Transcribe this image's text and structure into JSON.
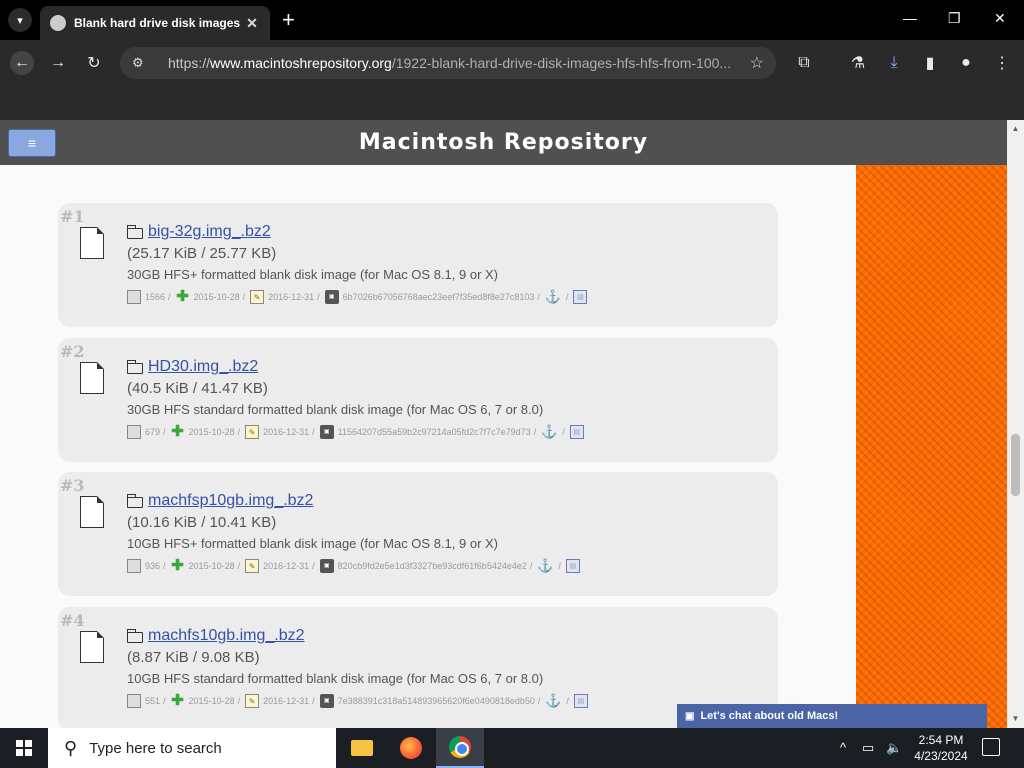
{
  "browser": {
    "tab_title": "Blank hard drive disk images H",
    "tab_close": "✕",
    "new_tab": "+",
    "url_prefix": "https://",
    "url_host": "www.macintoshrepository.org",
    "url_path": "/1922-blank-hard-drive-disk-images-hfs-hfs-from-100...",
    "window_controls": {
      "minimize": "—",
      "restore": "❐",
      "close": "✕"
    }
  },
  "site": {
    "menu_glyph": "≡",
    "title": "Macintosh Repository"
  },
  "items": [
    {
      "num": "#1",
      "name": "big-32g.img_.bz2",
      "size": "(25.17 KiB / 25.77 KB)",
      "desc": "30GB HFS+ formatted blank disk image (for Mac OS 8.1, 9 or X)",
      "downloads": "1566",
      "added": "2015-10-28",
      "edited": "2016-12-31",
      "sha": "6b7026b67056768aec23eef7f35ed8f8e27c8103"
    },
    {
      "num": "#2",
      "name": "HD30.img_.bz2",
      "size": "(40.5 KiB / 41.47 KB)",
      "desc": "30GB HFS standard formatted blank disk image (for Mac OS 6, 7 or 8.0)",
      "downloads": "679",
      "added": "2015-10-28",
      "edited": "2016-12-31",
      "sha": "11564207d55a59b2c97214a05fd2c7f7c7e79d73"
    },
    {
      "num": "#3",
      "name": "machfsp10gb.img_.bz2",
      "size": "(10.16 KiB / 10.41 KB)",
      "desc": "10GB HFS+ formatted blank disk image (for Mac OS 8.1, 9 or X)",
      "downloads": "936",
      "added": "2015-10-28",
      "edited": "2016-12-31",
      "sha": "820cb9fd2e5e1d3f3327be93cdf61f6b5424e4e2"
    },
    {
      "num": "#4",
      "name": "machfs10gb.img_.bz2",
      "size": "(8.87 KiB / 9.08 KB)",
      "desc": "10GB HFS standard formatted blank disk image (for Mac OS 6, 7 or 8.0)",
      "downloads": "551",
      "added": "2015-10-28",
      "edited": "2016-12-31",
      "sha": "7e388391c318a514893965620f6e0490818edb50"
    }
  ],
  "meta_sep": "/",
  "chat": {
    "label": "Let's chat about old Macs!"
  },
  "taskbar": {
    "search_placeholder": "Type here to search",
    "time": "2:54 PM",
    "date": "4/23/2024"
  }
}
